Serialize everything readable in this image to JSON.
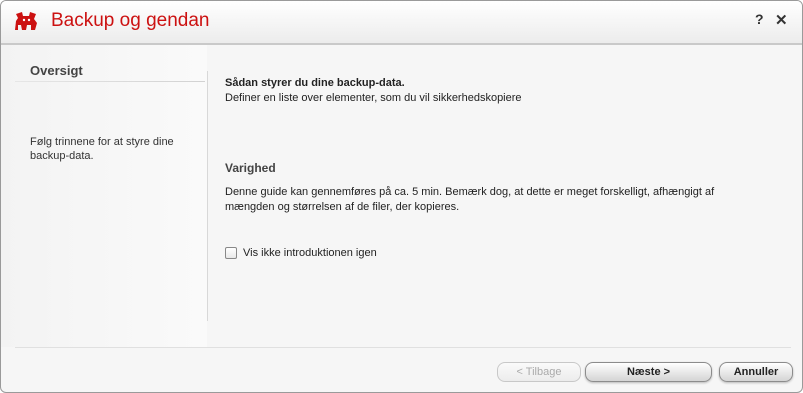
{
  "window": {
    "title": "Backup og gendan",
    "help_label": "?",
    "close_label": "✕",
    "brand_color": "#cc1111"
  },
  "sidebar": {
    "heading": "Oversigt",
    "description": "Følg trinnene for at styre dine backup-data."
  },
  "main": {
    "title": "Sådan styrer du dine backup-data.",
    "subtitle": "Definer en liste over elementer, som du vil sikkerhedskopiere",
    "duration_heading": "Varighed",
    "duration_text": "Denne guide kan gennemføres på ca. 5 min. Bemærk dog, at dette er meget forskelligt, afhængigt af mængden og størrelsen af de filer, der kopieres.",
    "checkbox_label": "Vis ikke introduktionen igen",
    "checkbox_checked": false
  },
  "buttons": {
    "back": "< Tilbage",
    "back_enabled": false,
    "next": "Næste >",
    "cancel": "Annuller"
  }
}
